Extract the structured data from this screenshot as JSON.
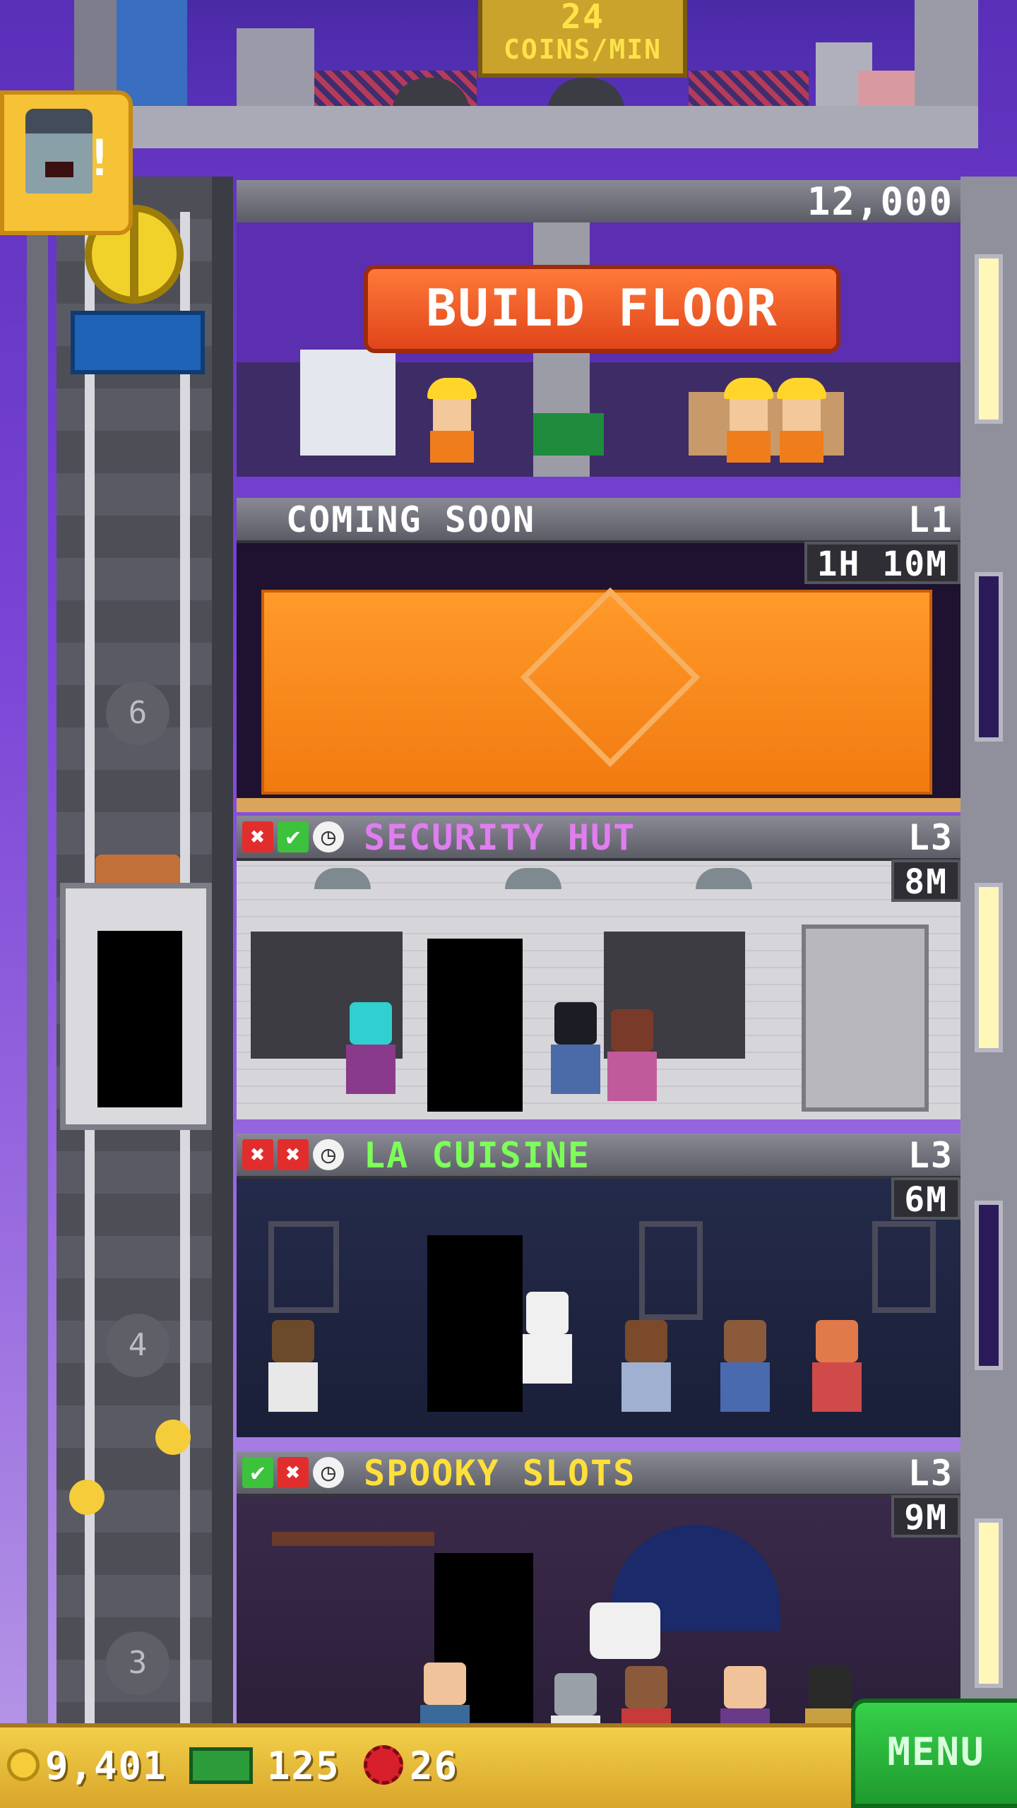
{
  "lobby": {
    "coins_rate_value": "24",
    "coins_rate_unit": "COINS/MIN"
  },
  "build_floor": {
    "price": "12,000",
    "button_label": "BUILD FLOOR"
  },
  "shaft": {
    "floor_numbers": [
      "6",
      "4",
      "3"
    ]
  },
  "floors": [
    {
      "name": "COMING SOON",
      "level": "L1",
      "timer": "1H 10M",
      "name_color": "#ffffff"
    },
    {
      "name": "SECURITY HUT",
      "level": "L3",
      "timer": "8M",
      "name_color": "#e07df0",
      "status": [
        "x",
        "ok",
        "clock"
      ]
    },
    {
      "name": "LA CUISINE",
      "level": "L3",
      "timer": "6M",
      "name_color": "#7dff5a",
      "status": [
        "x",
        "x",
        "clock"
      ]
    },
    {
      "name": "SPOOKY SLOTS",
      "level": "L3",
      "timer": "9M",
      "name_color": "#ffe03a",
      "status": [
        "ok",
        "x",
        "clock"
      ]
    }
  ],
  "status_glyphs": {
    "x": "✖",
    "ok": "✔",
    "clock": "◷"
  },
  "bottom_bar": {
    "coins": "9,401",
    "bux": "125",
    "points": "26",
    "menu_label": "MENU"
  },
  "icons": {
    "coin": "coin-icon",
    "bux": "tower-bux-icon",
    "points": "golden-ticket-icon",
    "alert": "exclamation-icon"
  }
}
